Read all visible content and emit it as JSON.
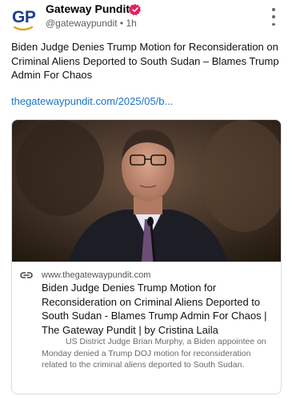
{
  "account": {
    "avatar_text": "GP",
    "display_name": "Gateway Pundit",
    "handle": "@gatewaypundit",
    "separator": "•",
    "time": "1h",
    "verified": true,
    "verified_color": "#e0245e"
  },
  "post": {
    "text": "Biden Judge Denies Trump Motion for Reconsideration on Criminal Aliens Deported to South Sudan – Blames Trump Admin For Chaos",
    "link_text": "thegatewaypundit.com/2025/05/b...",
    "link_color": "#1a73c7"
  },
  "card": {
    "domain": "www.thegatewaypundit.com",
    "title": "Biden Judge Denies Trump Motion for Reconsideration on Criminal Aliens Deported to South Sudan - Blames Trump Admin For Chaos | The Gateway Pundit | by Cristina Laila",
    "description": "US District Judge Brian Murphy, a Biden appointee on Monday denied a Trump DOJ motion for reconsideration related to the criminal aliens deported to South Sudan."
  },
  "icons": {
    "more": "more-vertical-icon",
    "verified": "verified-badge-icon",
    "link": "link-chain-icon"
  }
}
